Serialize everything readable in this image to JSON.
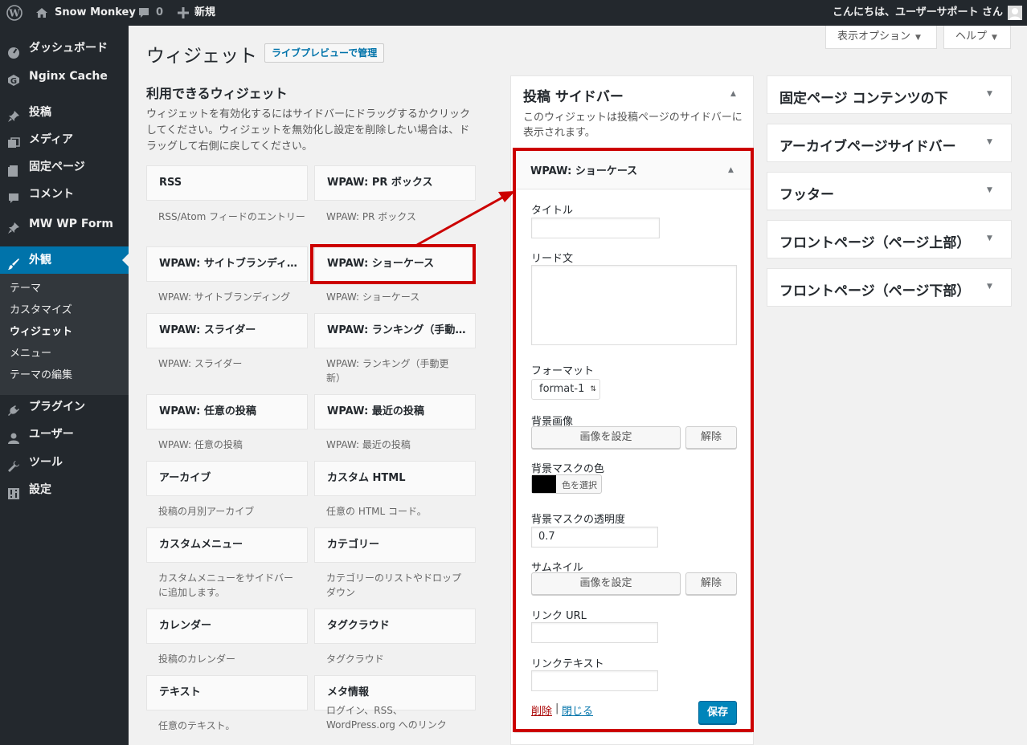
{
  "colors": {
    "accent": "#0073aa",
    "highlight": "#cc0000",
    "admin_bar": "#23282d",
    "delete_link": "#a00"
  },
  "admin_bar": {
    "wp_logo_icon": "wordpress-icon",
    "site_icon": "home-icon",
    "site_name": "Snow Monkey",
    "comments_icon": "comment-bubble-icon",
    "comments_count": "0",
    "new_icon": "plus-icon",
    "new_label": "新規",
    "greeting": "こんにちは、ユーザーサポート さん",
    "avatar_icon": "user-avatar-icon"
  },
  "sidebar": {
    "items": [
      {
        "label": "ダッシュボード",
        "icon": "dashboard-icon"
      },
      {
        "label": "Nginx Cache",
        "icon": "nginx-icon"
      },
      {
        "label": "投稿",
        "icon": "pin-icon"
      },
      {
        "label": "メディア",
        "icon": "media-icon"
      },
      {
        "label": "固定ページ",
        "icon": "page-icon"
      },
      {
        "label": "コメント",
        "icon": "comment-icon"
      },
      {
        "label": "MW WP Form",
        "icon": "pin-icon"
      },
      {
        "label": "外観",
        "icon": "brush-icon"
      },
      {
        "label": "プラグイン",
        "icon": "plugin-icon"
      },
      {
        "label": "ユーザー",
        "icon": "users-icon"
      },
      {
        "label": "ツール",
        "icon": "wrench-icon"
      },
      {
        "label": "設定",
        "icon": "settings-icon"
      }
    ],
    "submenu": [
      "テーマ",
      "カスタマイズ",
      "ウィジェット",
      "メニュー",
      "テーマの編集"
    ]
  },
  "screen_options": "表示オプション",
  "help": "ヘルプ",
  "page": {
    "title": "ウィジェット",
    "manage_live": "ライブプレビューで管理"
  },
  "available": {
    "title": "利用できるウィジェット",
    "description": "ウィジェットを有効化するにはサイドバーにドラッグするかクリックしてください。ウィジェットを無効化し設定を削除したい場合は、ドラッグして右側に戻してください。",
    "widgets": [
      {
        "name": "RSS",
        "desc": "RSS/Atom フィードのエントリー"
      },
      {
        "name": "WPAW: PR ボックス",
        "desc": "WPAW: PR ボックス"
      },
      {
        "name": "WPAW: サイトブランディング",
        "desc": "WPAW: サイトブランディング"
      },
      {
        "name": "WPAW: ショーケース",
        "desc": "WPAW: ショーケース"
      },
      {
        "name": "WPAW: スライダー",
        "desc": "WPAW: スライダー"
      },
      {
        "name": "WPAW: ランキング（手動更新）",
        "desc": "WPAW: ランキング（手動更新）"
      },
      {
        "name": "WPAW: 任意の投稿",
        "desc": "WPAW: 任意の投稿"
      },
      {
        "name": "WPAW: 最近の投稿",
        "desc": "WPAW: 最近の投稿"
      },
      {
        "name": "アーカイブ",
        "desc": "投稿の月別アーカイブ"
      },
      {
        "name": "カスタム HTML",
        "desc": "任意の HTML コード。"
      },
      {
        "name": "カスタムメニュー",
        "desc": "カスタムメニューをサイドバーに追加します。"
      },
      {
        "name": "カテゴリー",
        "desc": "カテゴリーのリストやドロップダウン"
      },
      {
        "name": "カレンダー",
        "desc": "投稿のカレンダー"
      },
      {
        "name": "タグクラウド",
        "desc": "タグクラウド"
      },
      {
        "name": "テキスト",
        "desc": "任意のテキスト。"
      },
      {
        "name": "メタ情報",
        "desc": "ログイン、RSS、WordPress.org へのリンク"
      }
    ]
  },
  "post_sidebar": {
    "title": "投稿 サイドバー",
    "description": "このウィジェットは投稿ページのサイドバーに表示されます。"
  },
  "open_widget": {
    "title": "WPAW: ショーケース",
    "title_label": "タイトル",
    "title_value": "",
    "lead_label": "リード文",
    "lead_value": "",
    "format_label": "フォーマット",
    "format_value": "format-1",
    "bg_image_label": "背景画像",
    "set_image": "画像を設定",
    "remove": "解除",
    "mask_color_label": "背景マスクの色",
    "mask_color": "#000000",
    "choose_color": "色を選択",
    "mask_opacity_label": "背景マスクの透明度",
    "mask_opacity_value": "0.7",
    "thumbnail_label": "サムネイル",
    "link_url_label": "リンク URL",
    "link_url_value": "",
    "link_text_label": "リンクテキスト",
    "link_text_value": "",
    "delete": "削除",
    "separator": "|",
    "close": "閉じる",
    "save": "保存"
  },
  "right_sidebars": [
    "固定ページ コンテンツの下",
    "アーカイブページサイドバー",
    "フッター",
    "フロントページ（ページ上部）",
    "フロントページ（ページ下部）"
  ]
}
